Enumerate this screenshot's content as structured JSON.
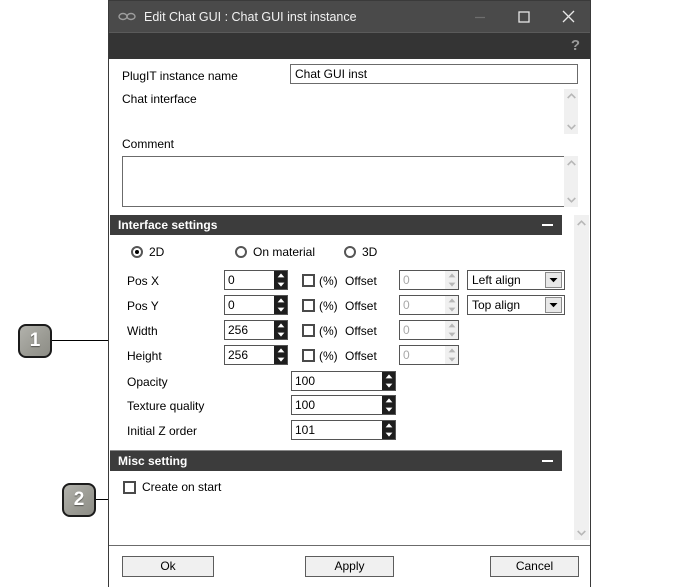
{
  "window": {
    "title": "Edit Chat GUI : Chat GUI inst instance",
    "app_icon": "goggles-icon",
    "minimize_label": "Minimize",
    "maximize_label": "Maximize",
    "close_label": "Close",
    "help_label": "?"
  },
  "form": {
    "instance_name_label": "PlugIT instance name",
    "instance_name_value": "Chat GUI inst",
    "instance_name_placeholder": "",
    "chat_interface_label": "Chat interface",
    "comment_label": "Comment",
    "comment_value": "",
    "comment_placeholder": ""
  },
  "interface_settings": {
    "header": "Interface settings",
    "collapse_label": "−",
    "modes": [
      {
        "label": "2D",
        "selected": true
      },
      {
        "label": "On material",
        "selected": false
      },
      {
        "label": "3D",
        "selected": false
      }
    ],
    "rows": [
      {
        "label": "Pos X",
        "value": "0",
        "percent_label": "(%)",
        "percent_checked": false,
        "offset_label": "Offset",
        "offset_value": "0",
        "offset_enabled": false,
        "align_value": "Left align",
        "has_align": true
      },
      {
        "label": "Pos Y",
        "value": "0",
        "percent_label": "(%)",
        "percent_checked": false,
        "offset_label": "Offset",
        "offset_value": "0",
        "offset_enabled": false,
        "align_value": "Top align",
        "has_align": true
      },
      {
        "label": "Width",
        "value": "256",
        "percent_label": "(%)",
        "percent_checked": false,
        "offset_label": "Offset",
        "offset_value": "0",
        "offset_enabled": false,
        "align_value": "",
        "has_align": false
      },
      {
        "label": "Height",
        "value": "256",
        "percent_label": "(%)",
        "percent_checked": false,
        "offset_label": "Offset",
        "offset_value": "0",
        "offset_enabled": false,
        "align_value": "",
        "has_align": false
      }
    ],
    "simple_rows": [
      {
        "label": "Opacity",
        "value": "100"
      },
      {
        "label": "Texture quality",
        "value": "100"
      },
      {
        "label": "Initial Z order",
        "value": "101"
      }
    ]
  },
  "misc_setting": {
    "header": "Misc setting",
    "collapse_label": "−",
    "create_on_start_label": "Create on start",
    "create_on_start_checked": false
  },
  "footer": {
    "ok_label": "Ok",
    "apply_label": "Apply",
    "cancel_label": "Cancel"
  },
  "annotations": [
    {
      "number": "1",
      "target": "Width"
    },
    {
      "number": "2",
      "target": "Create on start"
    }
  ],
  "colors": {
    "titlebar": "#4a4a4a",
    "toolbar": "#343434",
    "section_header": "#3c3c3c",
    "badge": "#9a9a93",
    "window_border": "#3a3a3a"
  }
}
